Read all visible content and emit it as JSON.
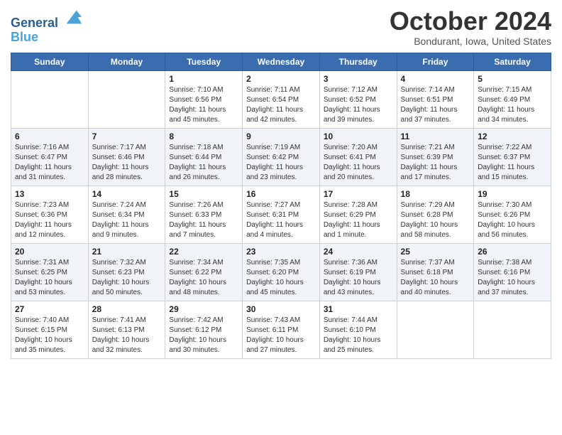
{
  "header": {
    "logo_line1": "General",
    "logo_line2": "Blue",
    "month_title": "October 2024",
    "location": "Bondurant, Iowa, United States"
  },
  "weekdays": [
    "Sunday",
    "Monday",
    "Tuesday",
    "Wednesday",
    "Thursday",
    "Friday",
    "Saturday"
  ],
  "weeks": [
    [
      {
        "day": "",
        "info": ""
      },
      {
        "day": "",
        "info": ""
      },
      {
        "day": "1",
        "info": "Sunrise: 7:10 AM\nSunset: 6:56 PM\nDaylight: 11 hours and 45 minutes."
      },
      {
        "day": "2",
        "info": "Sunrise: 7:11 AM\nSunset: 6:54 PM\nDaylight: 11 hours and 42 minutes."
      },
      {
        "day": "3",
        "info": "Sunrise: 7:12 AM\nSunset: 6:52 PM\nDaylight: 11 hours and 39 minutes."
      },
      {
        "day": "4",
        "info": "Sunrise: 7:14 AM\nSunset: 6:51 PM\nDaylight: 11 hours and 37 minutes."
      },
      {
        "day": "5",
        "info": "Sunrise: 7:15 AM\nSunset: 6:49 PM\nDaylight: 11 hours and 34 minutes."
      }
    ],
    [
      {
        "day": "6",
        "info": "Sunrise: 7:16 AM\nSunset: 6:47 PM\nDaylight: 11 hours and 31 minutes."
      },
      {
        "day": "7",
        "info": "Sunrise: 7:17 AM\nSunset: 6:46 PM\nDaylight: 11 hours and 28 minutes."
      },
      {
        "day": "8",
        "info": "Sunrise: 7:18 AM\nSunset: 6:44 PM\nDaylight: 11 hours and 26 minutes."
      },
      {
        "day": "9",
        "info": "Sunrise: 7:19 AM\nSunset: 6:42 PM\nDaylight: 11 hours and 23 minutes."
      },
      {
        "day": "10",
        "info": "Sunrise: 7:20 AM\nSunset: 6:41 PM\nDaylight: 11 hours and 20 minutes."
      },
      {
        "day": "11",
        "info": "Sunrise: 7:21 AM\nSunset: 6:39 PM\nDaylight: 11 hours and 17 minutes."
      },
      {
        "day": "12",
        "info": "Sunrise: 7:22 AM\nSunset: 6:37 PM\nDaylight: 11 hours and 15 minutes."
      }
    ],
    [
      {
        "day": "13",
        "info": "Sunrise: 7:23 AM\nSunset: 6:36 PM\nDaylight: 11 hours and 12 minutes."
      },
      {
        "day": "14",
        "info": "Sunrise: 7:24 AM\nSunset: 6:34 PM\nDaylight: 11 hours and 9 minutes."
      },
      {
        "day": "15",
        "info": "Sunrise: 7:26 AM\nSunset: 6:33 PM\nDaylight: 11 hours and 7 minutes."
      },
      {
        "day": "16",
        "info": "Sunrise: 7:27 AM\nSunset: 6:31 PM\nDaylight: 11 hours and 4 minutes."
      },
      {
        "day": "17",
        "info": "Sunrise: 7:28 AM\nSunset: 6:29 PM\nDaylight: 11 hours and 1 minute."
      },
      {
        "day": "18",
        "info": "Sunrise: 7:29 AM\nSunset: 6:28 PM\nDaylight: 10 hours and 58 minutes."
      },
      {
        "day": "19",
        "info": "Sunrise: 7:30 AM\nSunset: 6:26 PM\nDaylight: 10 hours and 56 minutes."
      }
    ],
    [
      {
        "day": "20",
        "info": "Sunrise: 7:31 AM\nSunset: 6:25 PM\nDaylight: 10 hours and 53 minutes."
      },
      {
        "day": "21",
        "info": "Sunrise: 7:32 AM\nSunset: 6:23 PM\nDaylight: 10 hours and 50 minutes."
      },
      {
        "day": "22",
        "info": "Sunrise: 7:34 AM\nSunset: 6:22 PM\nDaylight: 10 hours and 48 minutes."
      },
      {
        "day": "23",
        "info": "Sunrise: 7:35 AM\nSunset: 6:20 PM\nDaylight: 10 hours and 45 minutes."
      },
      {
        "day": "24",
        "info": "Sunrise: 7:36 AM\nSunset: 6:19 PM\nDaylight: 10 hours and 43 minutes."
      },
      {
        "day": "25",
        "info": "Sunrise: 7:37 AM\nSunset: 6:18 PM\nDaylight: 10 hours and 40 minutes."
      },
      {
        "day": "26",
        "info": "Sunrise: 7:38 AM\nSunset: 6:16 PM\nDaylight: 10 hours and 37 minutes."
      }
    ],
    [
      {
        "day": "27",
        "info": "Sunrise: 7:40 AM\nSunset: 6:15 PM\nDaylight: 10 hours and 35 minutes."
      },
      {
        "day": "28",
        "info": "Sunrise: 7:41 AM\nSunset: 6:13 PM\nDaylight: 10 hours and 32 minutes."
      },
      {
        "day": "29",
        "info": "Sunrise: 7:42 AM\nSunset: 6:12 PM\nDaylight: 10 hours and 30 minutes."
      },
      {
        "day": "30",
        "info": "Sunrise: 7:43 AM\nSunset: 6:11 PM\nDaylight: 10 hours and 27 minutes."
      },
      {
        "day": "31",
        "info": "Sunrise: 7:44 AM\nSunset: 6:10 PM\nDaylight: 10 hours and 25 minutes."
      },
      {
        "day": "",
        "info": ""
      },
      {
        "day": "",
        "info": ""
      }
    ]
  ]
}
